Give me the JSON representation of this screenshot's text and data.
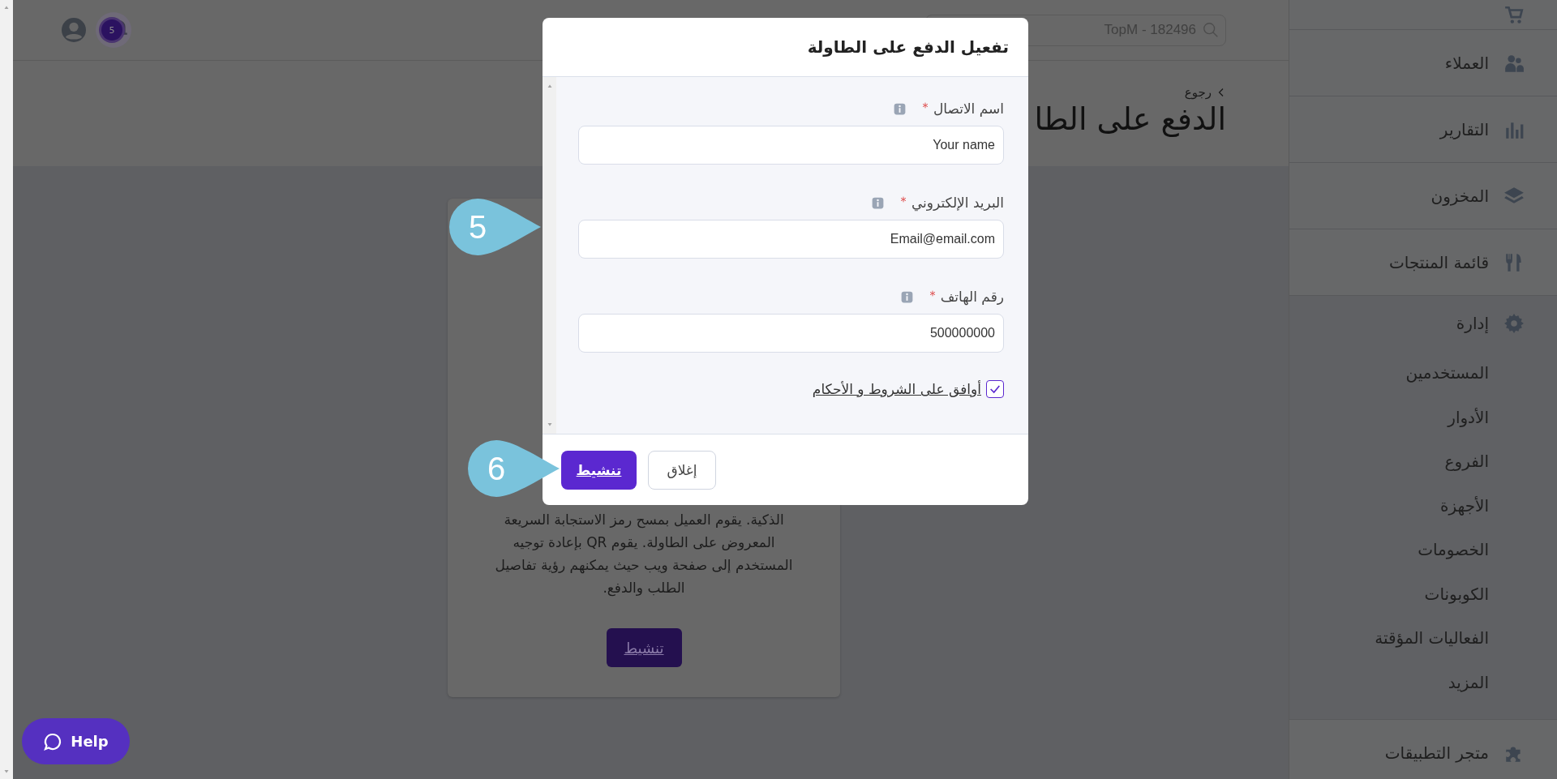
{
  "header": {
    "search": {
      "placeholder": "TopM - 182496"
    },
    "notifications": {
      "count": "5"
    }
  },
  "page": {
    "back_link": "رجوع",
    "title": "الدفع على الطا"
  },
  "card": {
    "description_lines": [
      "الذكية. يقوم العميل بمسح رمز الاستجابة السريعة",
      "المعروض على الطاولة. يقوم QR بإعادة توجيه",
      "المستخدم إلى صفحة ويب حيث يمكنهم رؤية تفاصيل",
      "الطلب والدفع."
    ],
    "button": "تنشيط"
  },
  "sidebar": {
    "items": [
      {
        "label": "العملاء",
        "expanded": false
      },
      {
        "label": "التقارير",
        "expanded": false
      },
      {
        "label": "المخزون",
        "expanded": false
      },
      {
        "label": "قائمة المنتجات",
        "expanded": false
      },
      {
        "label": "إدارة",
        "expanded": true,
        "children": [
          "المستخدمين",
          "الأدوار",
          "الفروع",
          "الأجهزة",
          "الخصومات",
          "الكوبونات",
          "الفعاليات المؤقتة",
          "المزيد"
        ]
      },
      {
        "label": "متجر التطبيقات",
        "expanded": false
      }
    ]
  },
  "modal": {
    "title": "تفعيل الدفع على الطاولة",
    "fields": [
      {
        "label": "اسم الاتصال",
        "required": true,
        "value": "Your name"
      },
      {
        "label": "البريد الإلكتروني",
        "required": true,
        "value": "Email@email.com"
      },
      {
        "label": "رقم الهاتف",
        "required": true,
        "value": "500000000"
      }
    ],
    "agreement": {
      "label": "أوافق على الشروط و الأحكام",
      "checked": true
    },
    "buttons": [
      {
        "label": "إغلاق",
        "kind": "secondary"
      },
      {
        "label": "تنشيط",
        "kind": "primary"
      }
    ]
  },
  "step_markers": [
    {
      "number": "5"
    },
    {
      "number": "6"
    }
  ],
  "help_button": {
    "label": "Help"
  }
}
